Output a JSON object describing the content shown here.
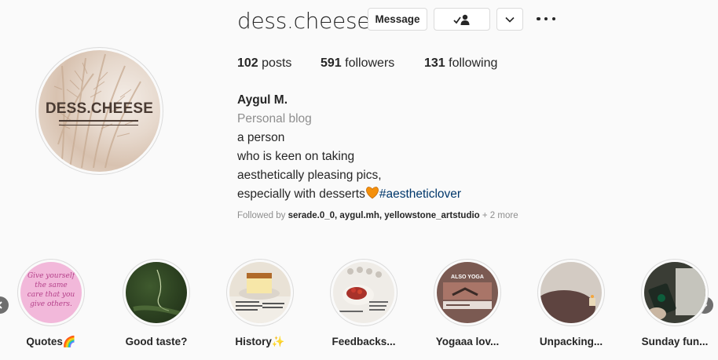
{
  "profile": {
    "username": "dess.cheese",
    "avatar_text": "DESS.CHEESE",
    "buttons": {
      "message": "Message",
      "follow_icon": "following-person-check-icon",
      "more_icon": "chevron-down-icon",
      "options_icon": "more-options-icon"
    },
    "stats": {
      "posts_count": "102",
      "posts_label": " posts",
      "followers_count": "591",
      "followers_label": " followers",
      "following_count": "131",
      "following_label": " following"
    },
    "bio": {
      "name": "Aygul M.",
      "category": "Personal blog",
      "line1": "a person",
      "line2": "who is keen on taking",
      "line3": "aesthetically pleasing pics,",
      "line4_text": "especially with desserts",
      "line4_emoji": "orange-heart-icon",
      "hashtag": "#aestheticlover"
    },
    "followed_by": {
      "prefix": "Followed by ",
      "users": "serade.0_0, aygul.mh, yellowstone_artstudio",
      "more": " + 2 more"
    }
  },
  "highlights": [
    {
      "label": "Quotes🌈",
      "image": "pink-handwritten-quote",
      "quote_text": "Give yourself the same care that you give others."
    },
    {
      "label": "Good taste?",
      "image": "dark-green-plant"
    },
    {
      "label": "History✨",
      "image": "cheesecake-slice"
    },
    {
      "label": "Feedbacks...",
      "image": "berry-dessert-plate"
    },
    {
      "label": "Yogaaa lov...",
      "image": "also-yoga-post",
      "banner_text": "ALSO YOGA"
    },
    {
      "label": "Unpacking...",
      "image": "table-with-candle"
    },
    {
      "label": "Sunday fun...",
      "image": "starbucks-cup"
    }
  ],
  "nav": {
    "prev_icon": "chevron-left-icon",
    "next_icon": "chevron-right-icon"
  },
  "colors": {
    "background": "#fafafa",
    "text": "#262626",
    "muted": "#8e8e8e",
    "hashtag": "#00376b",
    "border": "#dbdbdb"
  }
}
